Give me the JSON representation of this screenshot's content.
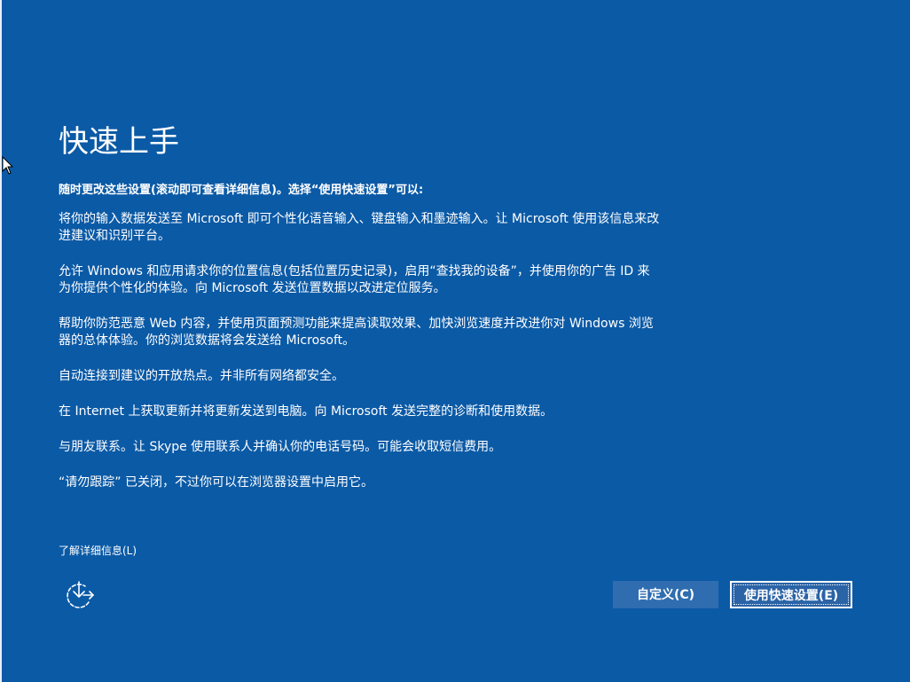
{
  "page": {
    "title": "快速上手",
    "intro": "随时更改这些设置(滚动即可查看详细信息)。选择“使用快速设置”可以:",
    "paragraphs": [
      "将你的输入数据发送至 Microsoft 即可个性化语音输入、键盘输入和墨迹输入。让 Microsoft 使用该信息来改进建议和识别平台。",
      "允许 Windows 和应用请求你的位置信息(包括位置历史记录)，启用“查找我的设备”，并使用你的广告 ID 来为你提供个性化的体验。向 Microsoft 发送位置数据以改进定位服务。",
      "帮助你防范恶意 Web 内容，并使用页面预测功能来提高读取效果、加快浏览速度并改进你对 Windows 浏览器的总体体验。你的浏览数据将会发送给 Microsoft。",
      "自动连接到建议的开放热点。并非所有网络都安全。",
      "在 Internet 上获取更新并将更新发送到电脑。向 Microsoft 发送完整的诊断和使用数据。",
      "与朋友联系。让 Skype 使用联系人并确认你的电话号码。可能会收取短信费用。",
      "“请勿跟踪” 已关闭，不过你可以在浏览器设置中启用它。"
    ],
    "learn_more": "了解详细信息(L)"
  },
  "buttons": {
    "customize": "自定义(C)",
    "express": "使用快速设置(E)"
  },
  "icons": {
    "accessibility": "ease-of-access-icon",
    "cursor": "mouse-pointer-icon"
  },
  "colors": {
    "background": "#0b5aa6",
    "button": "#2f6db0",
    "text": "#ffffff"
  }
}
